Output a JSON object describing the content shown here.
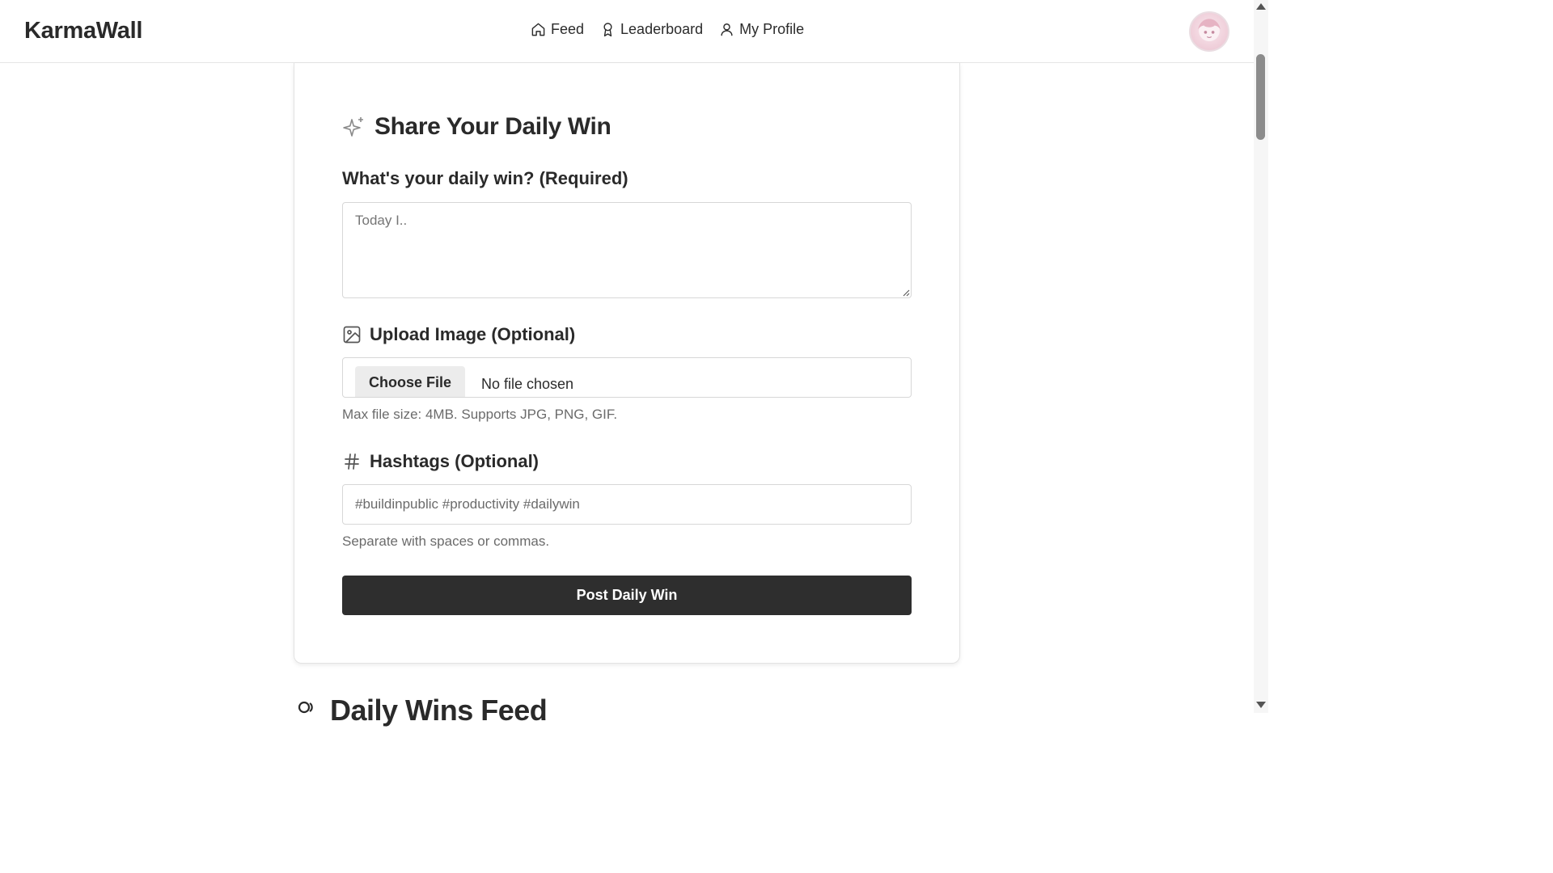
{
  "app": {
    "title": "KarmaWall"
  },
  "nav": {
    "items": [
      {
        "label": "Feed",
        "icon": "home-icon"
      },
      {
        "label": "Leaderboard",
        "icon": "award-icon"
      },
      {
        "label": "My Profile",
        "icon": "user-icon"
      }
    ]
  },
  "form": {
    "title": "Share Your Daily Win",
    "win_label": "What's your daily win? (Required)",
    "win_placeholder": "Today I..",
    "image_label": "Upload Image (Optional)",
    "choose_file_label": "Choose File",
    "file_status": "No file chosen",
    "image_help": "Max file size: 4MB. Supports JPG, PNG, GIF.",
    "hashtags_label": "Hashtags (Optional)",
    "hashtags_placeholder": "#buildinpublic #productivity #dailywin",
    "hashtags_help": "Separate with spaces or commas.",
    "submit_label": "Post Daily Win"
  },
  "feed": {
    "heading": "Daily Wins Feed"
  },
  "colors": {
    "primary_button": "#2e2e2e",
    "border": "#d7d7d7",
    "muted_text": "#6b6b6b"
  }
}
